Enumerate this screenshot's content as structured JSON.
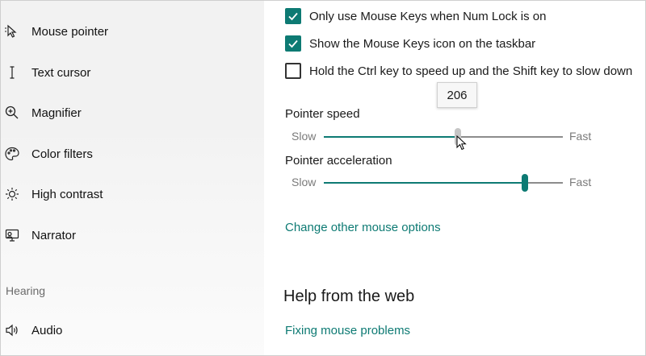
{
  "sidebar": {
    "items": [
      {
        "label": "Mouse pointer",
        "icon": "mouse-pointer-icon"
      },
      {
        "label": "Text cursor",
        "icon": "text-cursor-icon"
      },
      {
        "label": "Magnifier",
        "icon": "magnifier-icon"
      },
      {
        "label": "Color filters",
        "icon": "palette-icon"
      },
      {
        "label": "High contrast",
        "icon": "contrast-sun-icon"
      },
      {
        "label": "Narrator",
        "icon": "narrator-icon"
      }
    ],
    "hearing_section": "Hearing",
    "hearing_items": [
      {
        "label": "Audio",
        "icon": "speaker-icon"
      }
    ]
  },
  "main": {
    "options": [
      {
        "label": "Only use Mouse Keys when Num Lock is on",
        "checked": true
      },
      {
        "label": "Show the Mouse Keys icon on the taskbar",
        "checked": true
      },
      {
        "label": "Hold the Ctrl key to speed up and the Shift key to slow down",
        "checked": false
      }
    ],
    "pointer_speed": {
      "label": "Pointer speed",
      "slow": "Slow",
      "fast": "Fast",
      "tooltip": "206",
      "fraction": 0.56
    },
    "pointer_acceleration": {
      "label": "Pointer acceleration",
      "slow": "Slow",
      "fast": "Fast",
      "fraction": 0.84
    },
    "change_link": "Change other mouse options",
    "help_title": "Help from the web",
    "help_link": "Fixing mouse problems"
  },
  "colors": {
    "accent": "#0d7a73",
    "track": "#8c8c8c",
    "thumb_inactive": "#c6c6c6"
  }
}
